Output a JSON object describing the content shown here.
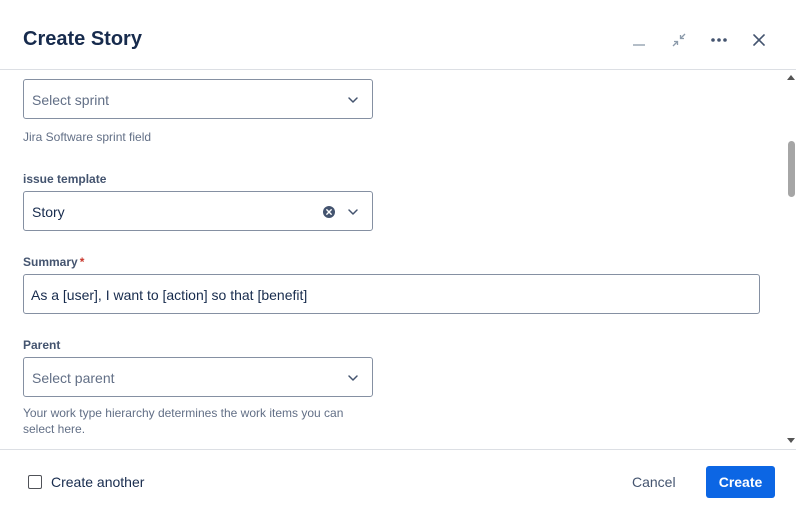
{
  "dialog": {
    "title": "Create Story"
  },
  "fields": {
    "sprint": {
      "placeholder": "Select sprint",
      "helper": "Jira Software sprint field"
    },
    "issue_template": {
      "label": "issue template",
      "value": "Story"
    },
    "summary": {
      "label": "Summary",
      "required_marker": "*",
      "value": "As a [user], I want to [action] so that [benefit]"
    },
    "parent": {
      "label": "Parent",
      "placeholder": "Select parent",
      "helper_line1": "Your work type hierarchy determines the work items you can",
      "helper_line2": "select here."
    }
  },
  "footer": {
    "create_another_label": "Create another",
    "create_another_checked": false,
    "cancel_label": "Cancel",
    "create_label": "Create"
  },
  "colors": {
    "primary": "#0c66e4",
    "required": "#c9372c",
    "text": "#172b4d",
    "subtle_text": "#626f86",
    "border": "#8590a2"
  }
}
